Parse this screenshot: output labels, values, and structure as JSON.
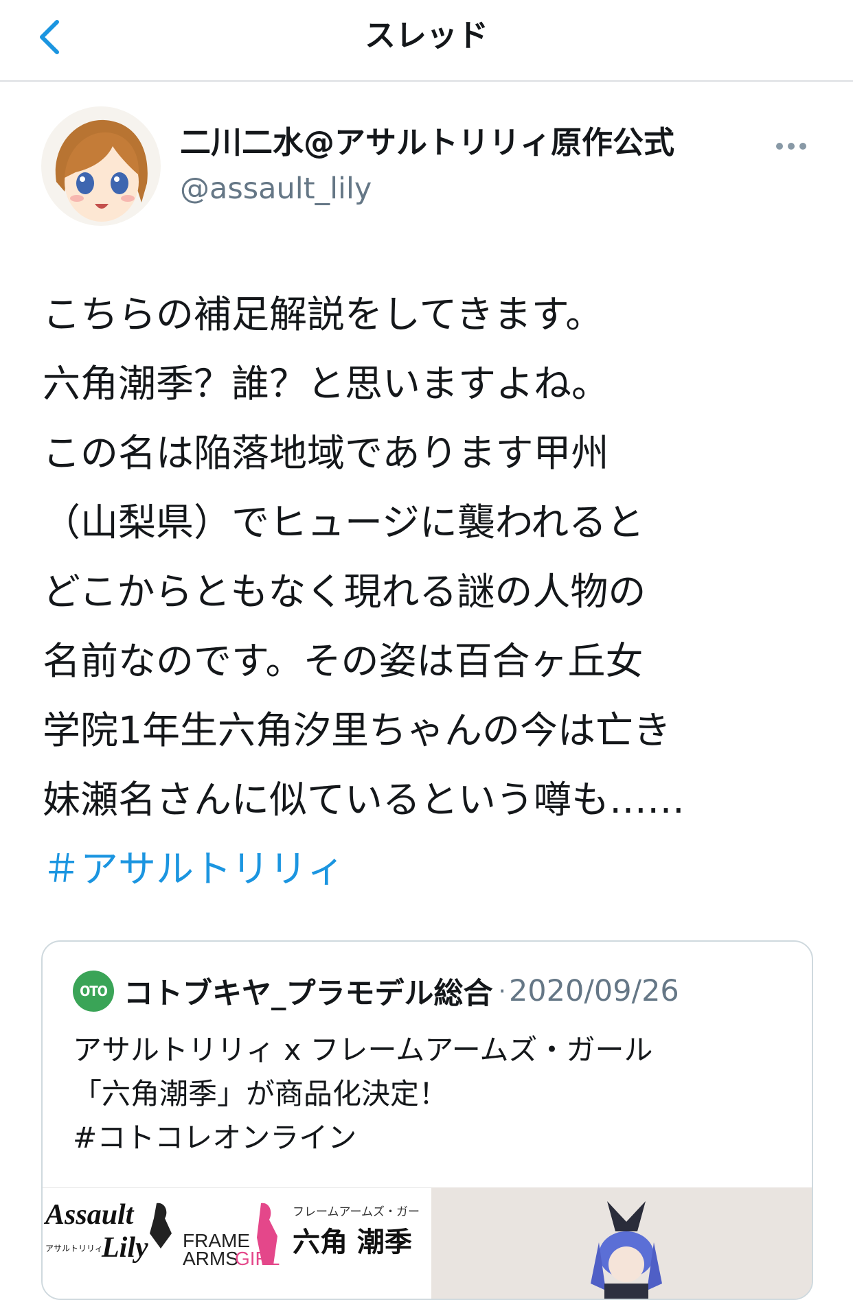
{
  "header": {
    "title": "スレッド",
    "back_icon": "chevron-left-icon",
    "accent": "#1b95e0"
  },
  "author": {
    "display_name": "二川二水@アサルトリリィ原作公式",
    "handle": "@assault_lily",
    "more_icon": "more-horizontal-icon"
  },
  "tweet": {
    "lines": [
      "こちらの補足解説をしてきます。",
      "六角潮季？誰？と思いますよね。",
      "この名は陥落地域であります甲州",
      "（山梨県）でヒュージに襲われると",
      "どこからともなく現れる謎の人物の",
      "名前なのです。その姿は百合ヶ丘女",
      "学院1年生六角汐里ちゃんの今は亡き",
      "妹瀬名さんに似ているという噂も……"
    ],
    "hashtag": "＃アサルトリリィ"
  },
  "quoted": {
    "avatar_text": "OTO",
    "name": "コトブキヤ_プラモデル総合",
    "separator": "·",
    "date": "2020/09/26",
    "lines": [
      "アサルトリリィ x フレームアームズ・ガール",
      "「六角潮季」が商品化決定！",
      "#コトコレオンライン"
    ],
    "media": {
      "logo_assault": "Assault",
      "logo_lily": "Lily",
      "logo_assault_sub": "アサルトリリィ",
      "logo_frame": "FRAME",
      "logo_arms": "ARMS",
      "logo_girl": "GIRL",
      "product_sub": "フレームアームズ・ガー",
      "product_name": "六角 潮季"
    }
  }
}
